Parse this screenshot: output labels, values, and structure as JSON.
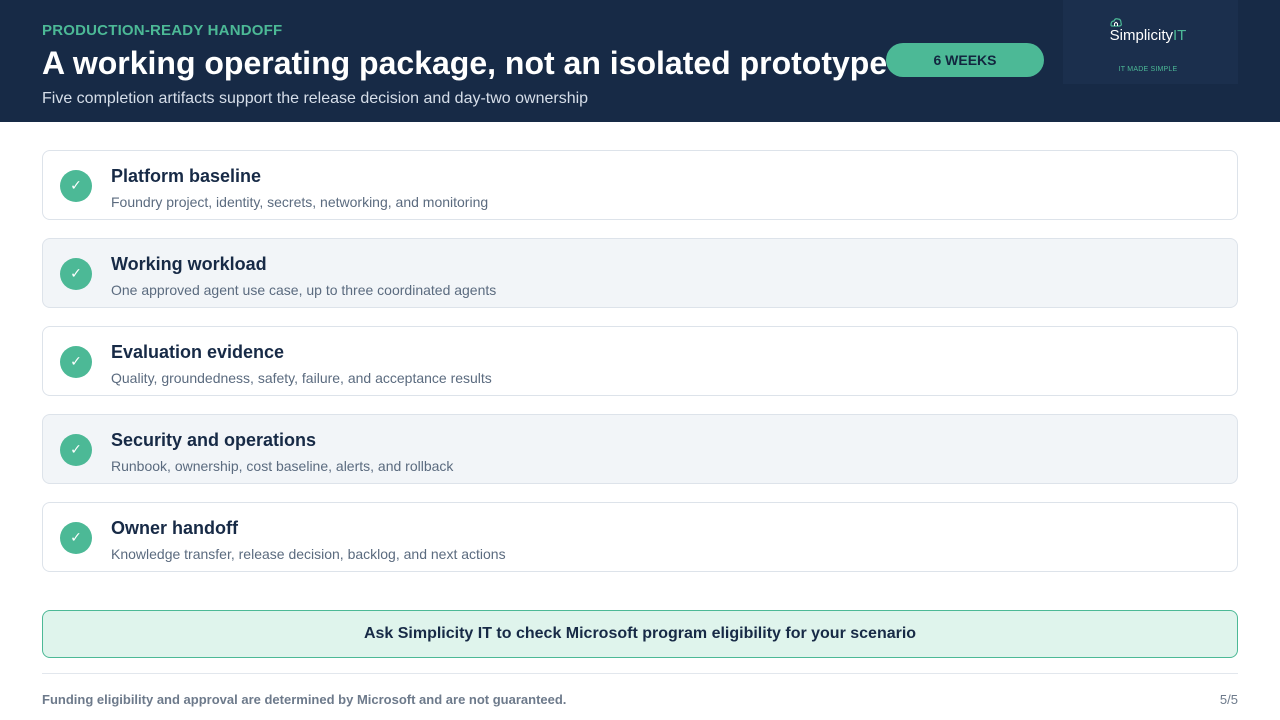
{
  "header": {
    "eyebrow": "PRODUCTION-READY HANDOFF",
    "title": "A working operating package, not an isolated prototype",
    "subtitle": "Five completion artifacts support the release decision and day-two ownership",
    "badge": "6 WEEKS",
    "logo": {
      "name_main": "Simplicity",
      "name_accent": "IT",
      "tagline": "IT MADE SIMPLE"
    }
  },
  "artifacts": [
    {
      "title": "Platform baseline",
      "description": "Foundry project, identity, secrets, networking, and monitoring"
    },
    {
      "title": "Working workload",
      "description": "One approved agent use case, up to three coordinated agents"
    },
    {
      "title": "Evaluation evidence",
      "description": "Quality, groundedness, safety, failure, and acceptance results"
    },
    {
      "title": "Security and operations",
      "description": "Runbook, ownership, cost baseline, alerts, and rollback"
    },
    {
      "title": "Owner handoff",
      "description": "Knowledge transfer, release decision, backlog, and next actions"
    }
  ],
  "check_glyph": "✓",
  "cta": "Ask Simplicity IT to check Microsoft program eligibility for your scenario",
  "footer": {
    "note": "Funding eligibility and approval are determined by Microsoft and are not guaranteed.",
    "page": "5/5"
  },
  "colors": {
    "navy": "#172a46",
    "accent_green": "#4cb996",
    "cta_background": "#dff4ec"
  }
}
